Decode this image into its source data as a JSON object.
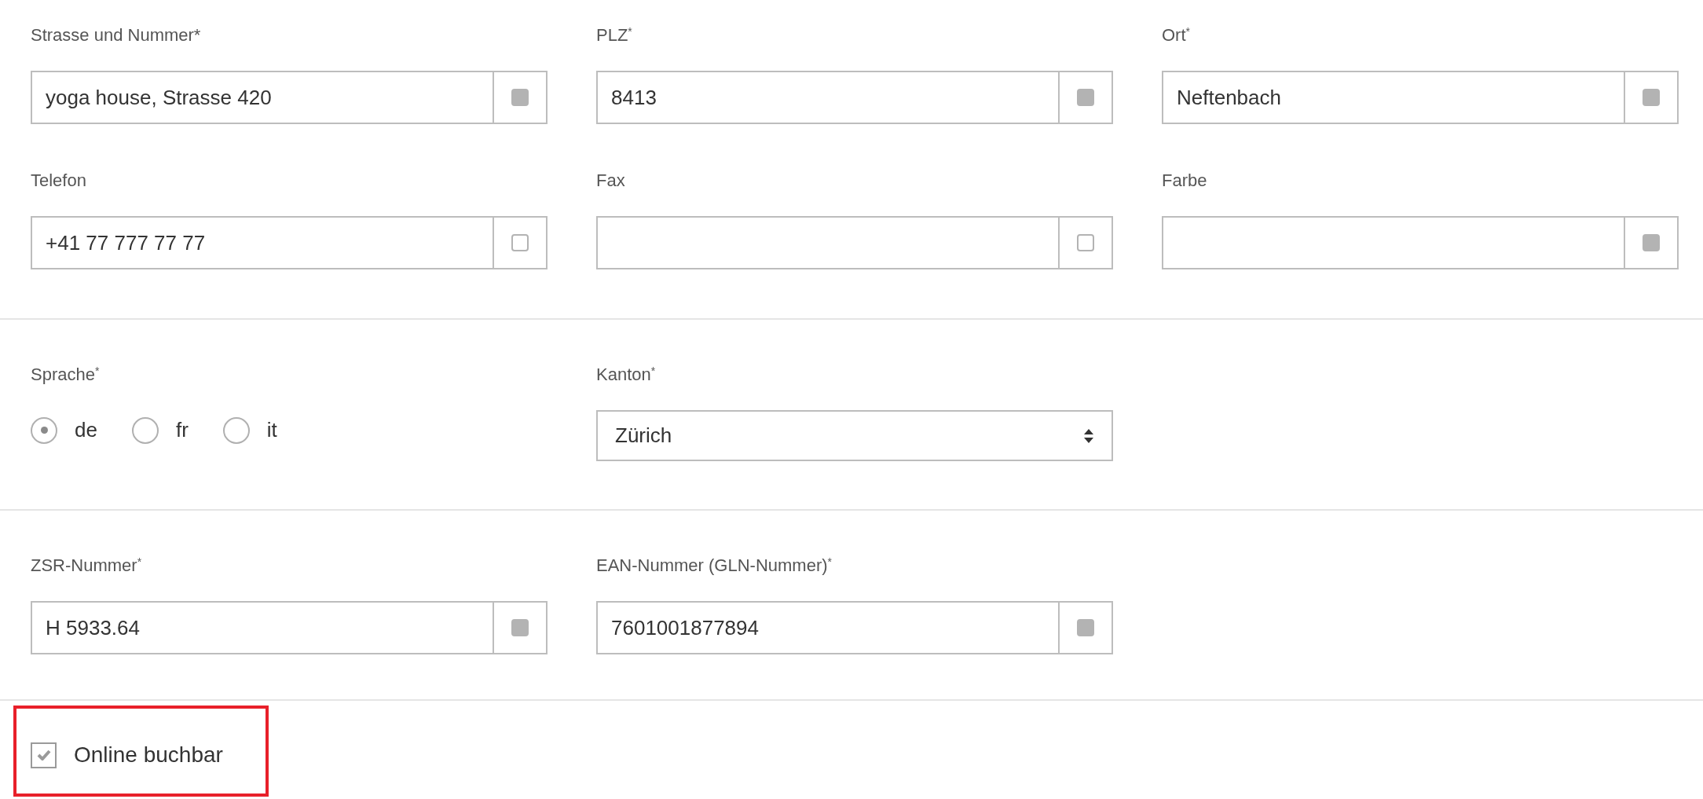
{
  "sections": [
    {
      "kind": "fields",
      "fields": [
        {
          "label": "Strasse und Nummer*",
          "value": "yoga house, Strasse 420",
          "addon_checked": true
        },
        {
          "label": "PLZ$^{*}$",
          "value": "8413",
          "addon_checked": true
        },
        {
          "label": "Ort$^{*}$",
          "value": "Neftenbach",
          "addon_checked": true
        },
        {
          "label": "Telefon",
          "value": "+41 77 777 77 77",
          "addon_checked": false
        },
        {
          "label": "Fax",
          "addon_checked": false
        },
        {
          "label": "Farbe",
          "addon_checked": true
        }
      ]
    },
    {
      "kind": "choices",
      "radio_group": {
        "label": "Sprache$^{*}$",
        "options": [
          {
            "label": "de",
            "selected": true
          },
          {
            "label": "fr",
            "selected": false
          },
          {
            "label": "it",
            "selected": false
          }
        ]
      },
      "select": {
        "label": "Kanton$^{*}$",
        "value": "Zürich"
      }
    },
    {
      "kind": "fields",
      "fields": [
        {
          "label": "ZSR-Nummer$^{*}$",
          "value": "H 5933.64",
          "addon_checked": true
        },
        {
          "label": "EAN-Nummer (GLN-Nummer)$^{*}$",
          "value": "7601001877894",
          "addon_checked": true
        }
      ]
    },
    {
      "kind": "checkbox",
      "label": "Online buchbar",
      "checked": true,
      "highlighted": true
    }
  ]
}
